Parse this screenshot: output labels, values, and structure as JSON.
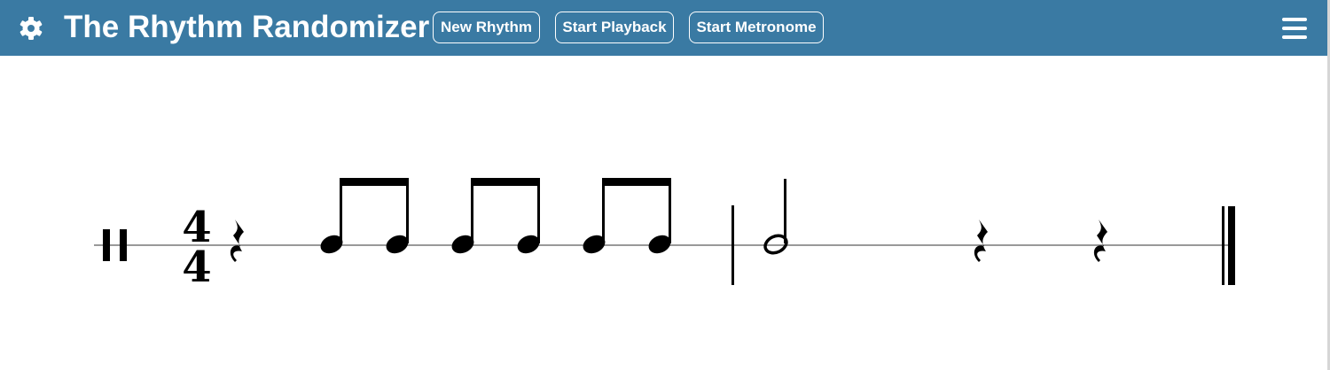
{
  "app": {
    "title": "The Rhythm Randomizer"
  },
  "toolbar": {
    "settings_icon": "gear-icon",
    "new_rhythm_label": "New Rhythm",
    "start_playback_label": "Start Playback",
    "start_metronome_label": "Start Metronome",
    "menu_icon": "hamburger-menu-icon"
  },
  "colors": {
    "header_bg": "#3a7aa3",
    "header_text": "#ffffff",
    "notation": "#000000",
    "staff_line": "#999999"
  },
  "notation": {
    "clef": "percussion",
    "time_signature": {
      "beats": "4",
      "beat_unit": "4"
    },
    "measures": [
      {
        "events": [
          "quarter-rest",
          "eighth-note-pair",
          "eighth-note-pair",
          "eighth-note-pair"
        ]
      },
      {
        "events": [
          "half-note",
          "quarter-rest",
          "quarter-rest"
        ]
      }
    ],
    "end_barline": "final"
  }
}
